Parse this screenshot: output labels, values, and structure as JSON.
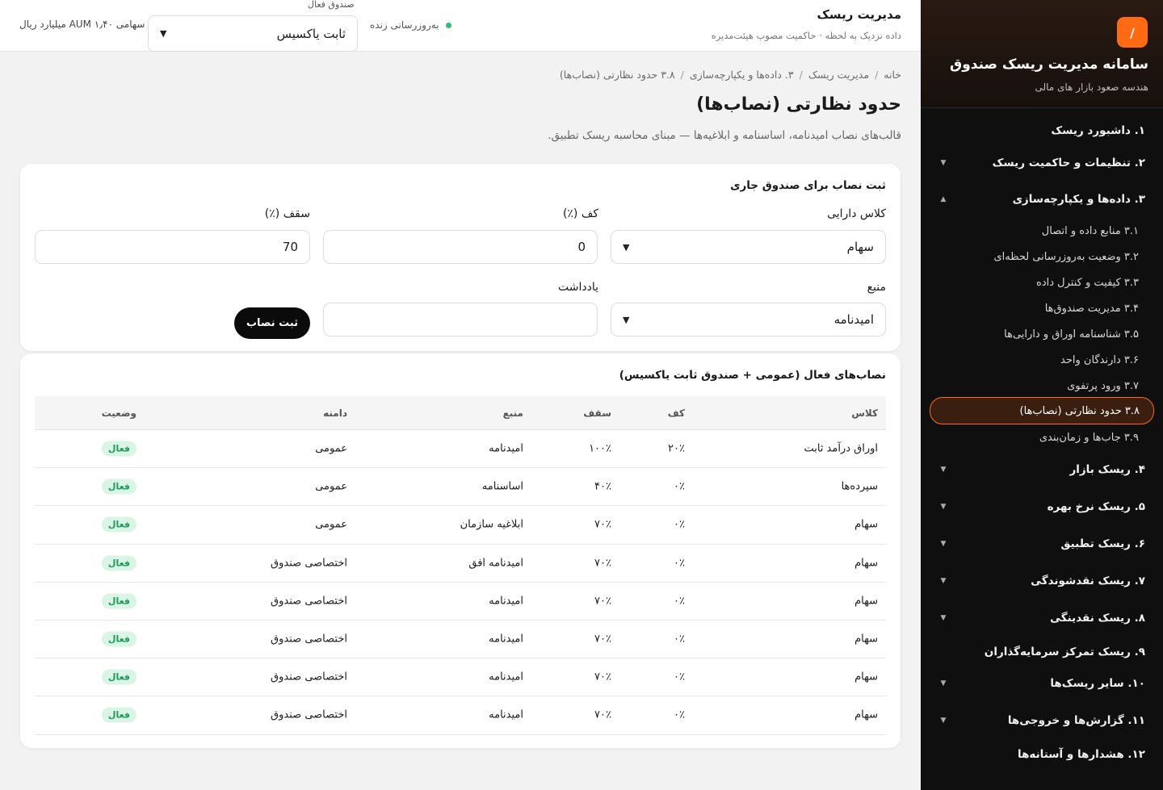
{
  "sidebar": {
    "logo_glyph": "/",
    "title": "سامانه مدیریت ریسک صندوق",
    "subtitle": "هندسه صعود بازار های مالی",
    "items": [
      {
        "label": "۱. داشبورد ریسک",
        "chevron": ""
      },
      {
        "label": "۲. تنظیمات و حاکمیت ریسک",
        "chevron": "▼"
      },
      {
        "label": "۳. داده‌ها و یکپارچه‌سازی",
        "chevron": "▲"
      },
      {
        "label": "۴. ریسک بازار",
        "chevron": "▼"
      },
      {
        "label": "۵. ریسک نرخ بهره",
        "chevron": "▼"
      },
      {
        "label": "۶. ریسک تطبیق",
        "chevron": "▼"
      },
      {
        "label": "۷. ریسک نقدشوندگی",
        "chevron": "▼"
      },
      {
        "label": "۸. ریسک نقدینگی",
        "chevron": "▼"
      },
      {
        "label": "۹. ریسک تمرکز سرمایه‌گذاران",
        "chevron": ""
      },
      {
        "label": "۱۰. سایر ریسک‌ها",
        "chevron": "▼"
      },
      {
        "label": "۱۱. گزارش‌ها و خروجی‌ها",
        "chevron": "▼"
      },
      {
        "label": "۱۲. هشدارها و آستانه‌ها",
        "chevron": ""
      }
    ],
    "subitems": [
      "۳.۱ منابع داده و اتصال",
      "۳.۲ وضعیت به‌روزرسانی لحظه‌ای",
      "۳.۳ کیفیت و کنترل داده",
      "۳.۴ مدیریت صندوق‌ها",
      "۳.۵ شناسنامه اوراق و دارایی‌ها",
      "۳.۶ دارندگان واحد",
      "۳.۷ ورود پرتفوی",
      "۳.۸ حدود نظارتی (نصاب‌ها)",
      "۳.۹ جاب‌ها و زمان‌بندی"
    ]
  },
  "topbar": {
    "title": "مدیریت ریسک",
    "subtitle": "داده نزدیک به لحظه · حاکمیت مصوب هیئت‌مدیره",
    "live_label": "به‌روزرسانی زنده",
    "fund_label": "صندوق فعال",
    "fund_value": "ثابت یاکسیس",
    "aum_text": "سهامی AUM ۱٫۴۰ میلیارد ریال"
  },
  "breadcrumb": [
    "خانه",
    "مدیریت ریسک",
    "۳. داده‌ها و یکپارچه‌سازی",
    "۳.۸ حدود نظارتی (نصاب‌ها)"
  ],
  "page": {
    "title": "حدود نظارتی (نصاب‌ها)",
    "description": "قالب‌های نصاب امیدنامه، اساسنامه و ابلاغیه‌ها — مبنای محاسبه ریسک تطبیق."
  },
  "form": {
    "title": "ثبت نصاب برای صندوق جاری",
    "asset_class_label": "کلاس دارایی",
    "asset_class_value": "سهام",
    "floor_label": "کف (٪)",
    "floor_value": "0",
    "cap_label": "سقف (٪)",
    "cap_value": "70",
    "source_label": "منبع",
    "source_value": "امیدنامه",
    "note_label": "یادداشت",
    "note_value": "",
    "submit_label": "ثبت نصاب"
  },
  "table": {
    "title": "نصاب‌های فعال (عمومی + صندوق ثابت یاکسیس)",
    "headers": {
      "class": "کلاس",
      "floor": "کف",
      "cap": "سقف",
      "source": "منبع",
      "scope": "دامنه",
      "status": "وضعیت"
    },
    "rows": [
      {
        "class": "اوراق درآمد ثابت",
        "floor": "۲۰٪",
        "cap": "۱۰۰٪",
        "source": "امیدنامه",
        "scope": "عمومی",
        "status": "فعال"
      },
      {
        "class": "سپرده‌ها",
        "floor": "۰٪",
        "cap": "۴۰٪",
        "source": "اساسنامه",
        "scope": "عمومی",
        "status": "فعال"
      },
      {
        "class": "سهام",
        "floor": "۰٪",
        "cap": "۷۰٪",
        "source": "ابلاغیه سازمان",
        "scope": "عمومی",
        "status": "فعال"
      },
      {
        "class": "سهام",
        "floor": "۰٪",
        "cap": "۷۰٪",
        "source": "امیدنامه افق",
        "scope": "اختصاصی صندوق",
        "status": "فعال"
      },
      {
        "class": "سهام",
        "floor": "۰٪",
        "cap": "۷۰٪",
        "source": "امیدنامه",
        "scope": "اختصاصی صندوق",
        "status": "فعال"
      },
      {
        "class": "سهام",
        "floor": "۰٪",
        "cap": "۷۰٪",
        "source": "امیدنامه",
        "scope": "اختصاصی صندوق",
        "status": "فعال"
      },
      {
        "class": "سهام",
        "floor": "۰٪",
        "cap": "۷۰٪",
        "source": "امیدنامه",
        "scope": "اختصاصی صندوق",
        "status": "فعال"
      },
      {
        "class": "سهام",
        "floor": "۰٪",
        "cap": "۷۰٪",
        "source": "امیدنامه",
        "scope": "اختصاصی صندوق",
        "status": "فعال"
      }
    ]
  },
  "colors": {
    "accent": "#ff6a13",
    "sidebar_bg": "#0f0f0f",
    "live_dot": "#2fbf71",
    "badge_bg": "#d9f5e5",
    "badge_text": "#1f9a58"
  }
}
